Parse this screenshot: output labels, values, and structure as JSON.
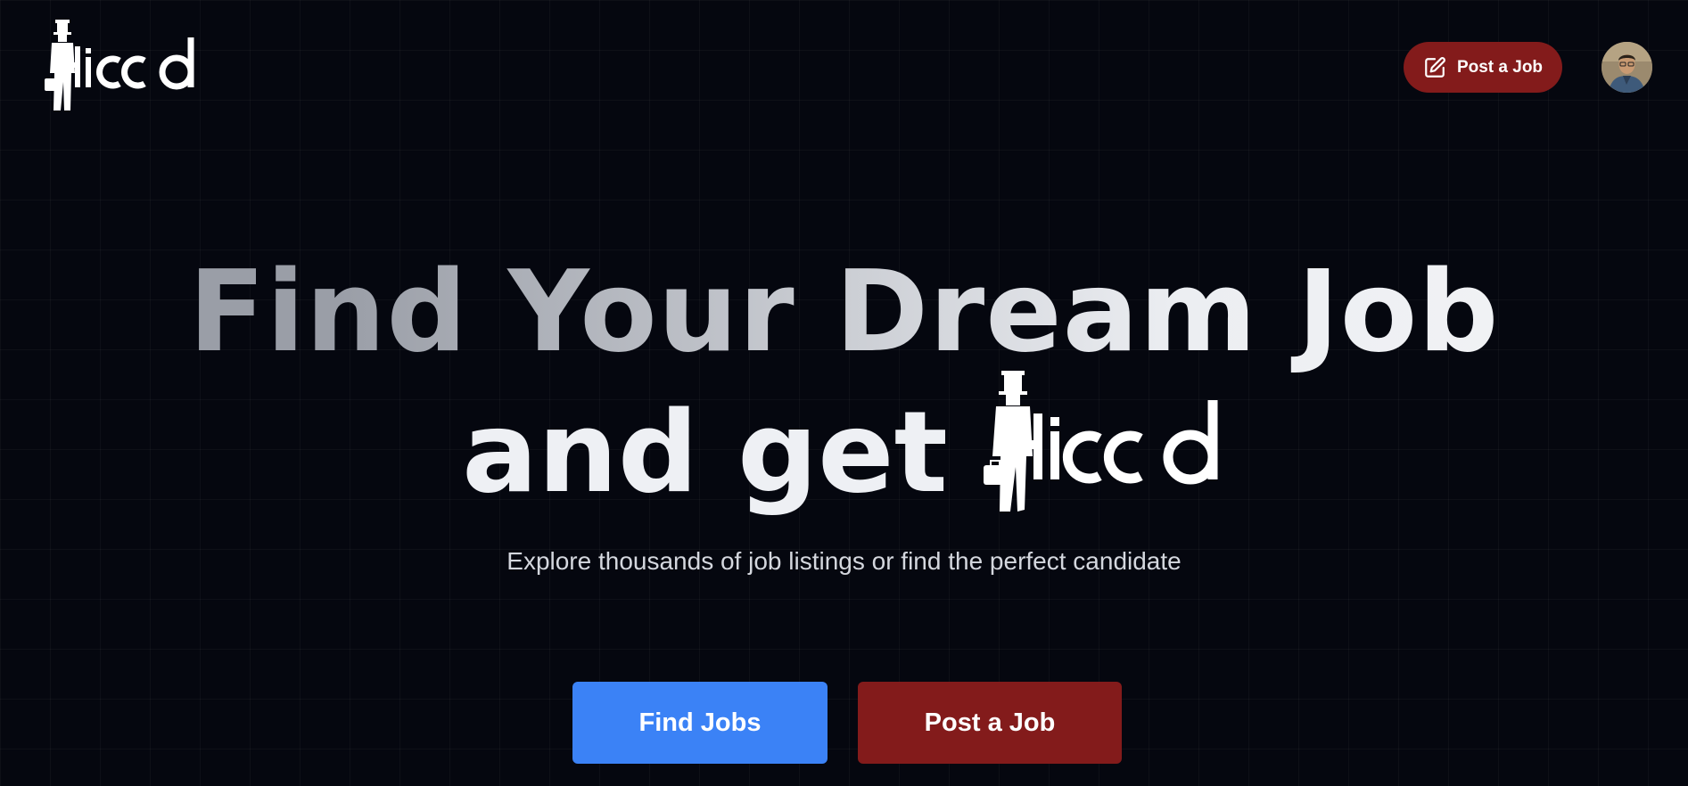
{
  "header": {
    "logo_alt": "Hirrd",
    "post_job_label": "Post a Job",
    "pen_icon": "pen-square-icon",
    "avatar": "user-avatar"
  },
  "hero": {
    "title_line1": "Find Your Dream Job",
    "title_line2": "and get",
    "logo_alt": "Hirrd",
    "subtitle": "Explore thousands of job listings or find the perfect candidate"
  },
  "actions": {
    "find_jobs_label": "Find Jobs",
    "post_job_label": "Post a Job"
  },
  "colors": {
    "background": "#05070f",
    "primary_blue": "#3b82f6",
    "brand_red": "#831b1b",
    "text_light": "#d4d7de"
  }
}
